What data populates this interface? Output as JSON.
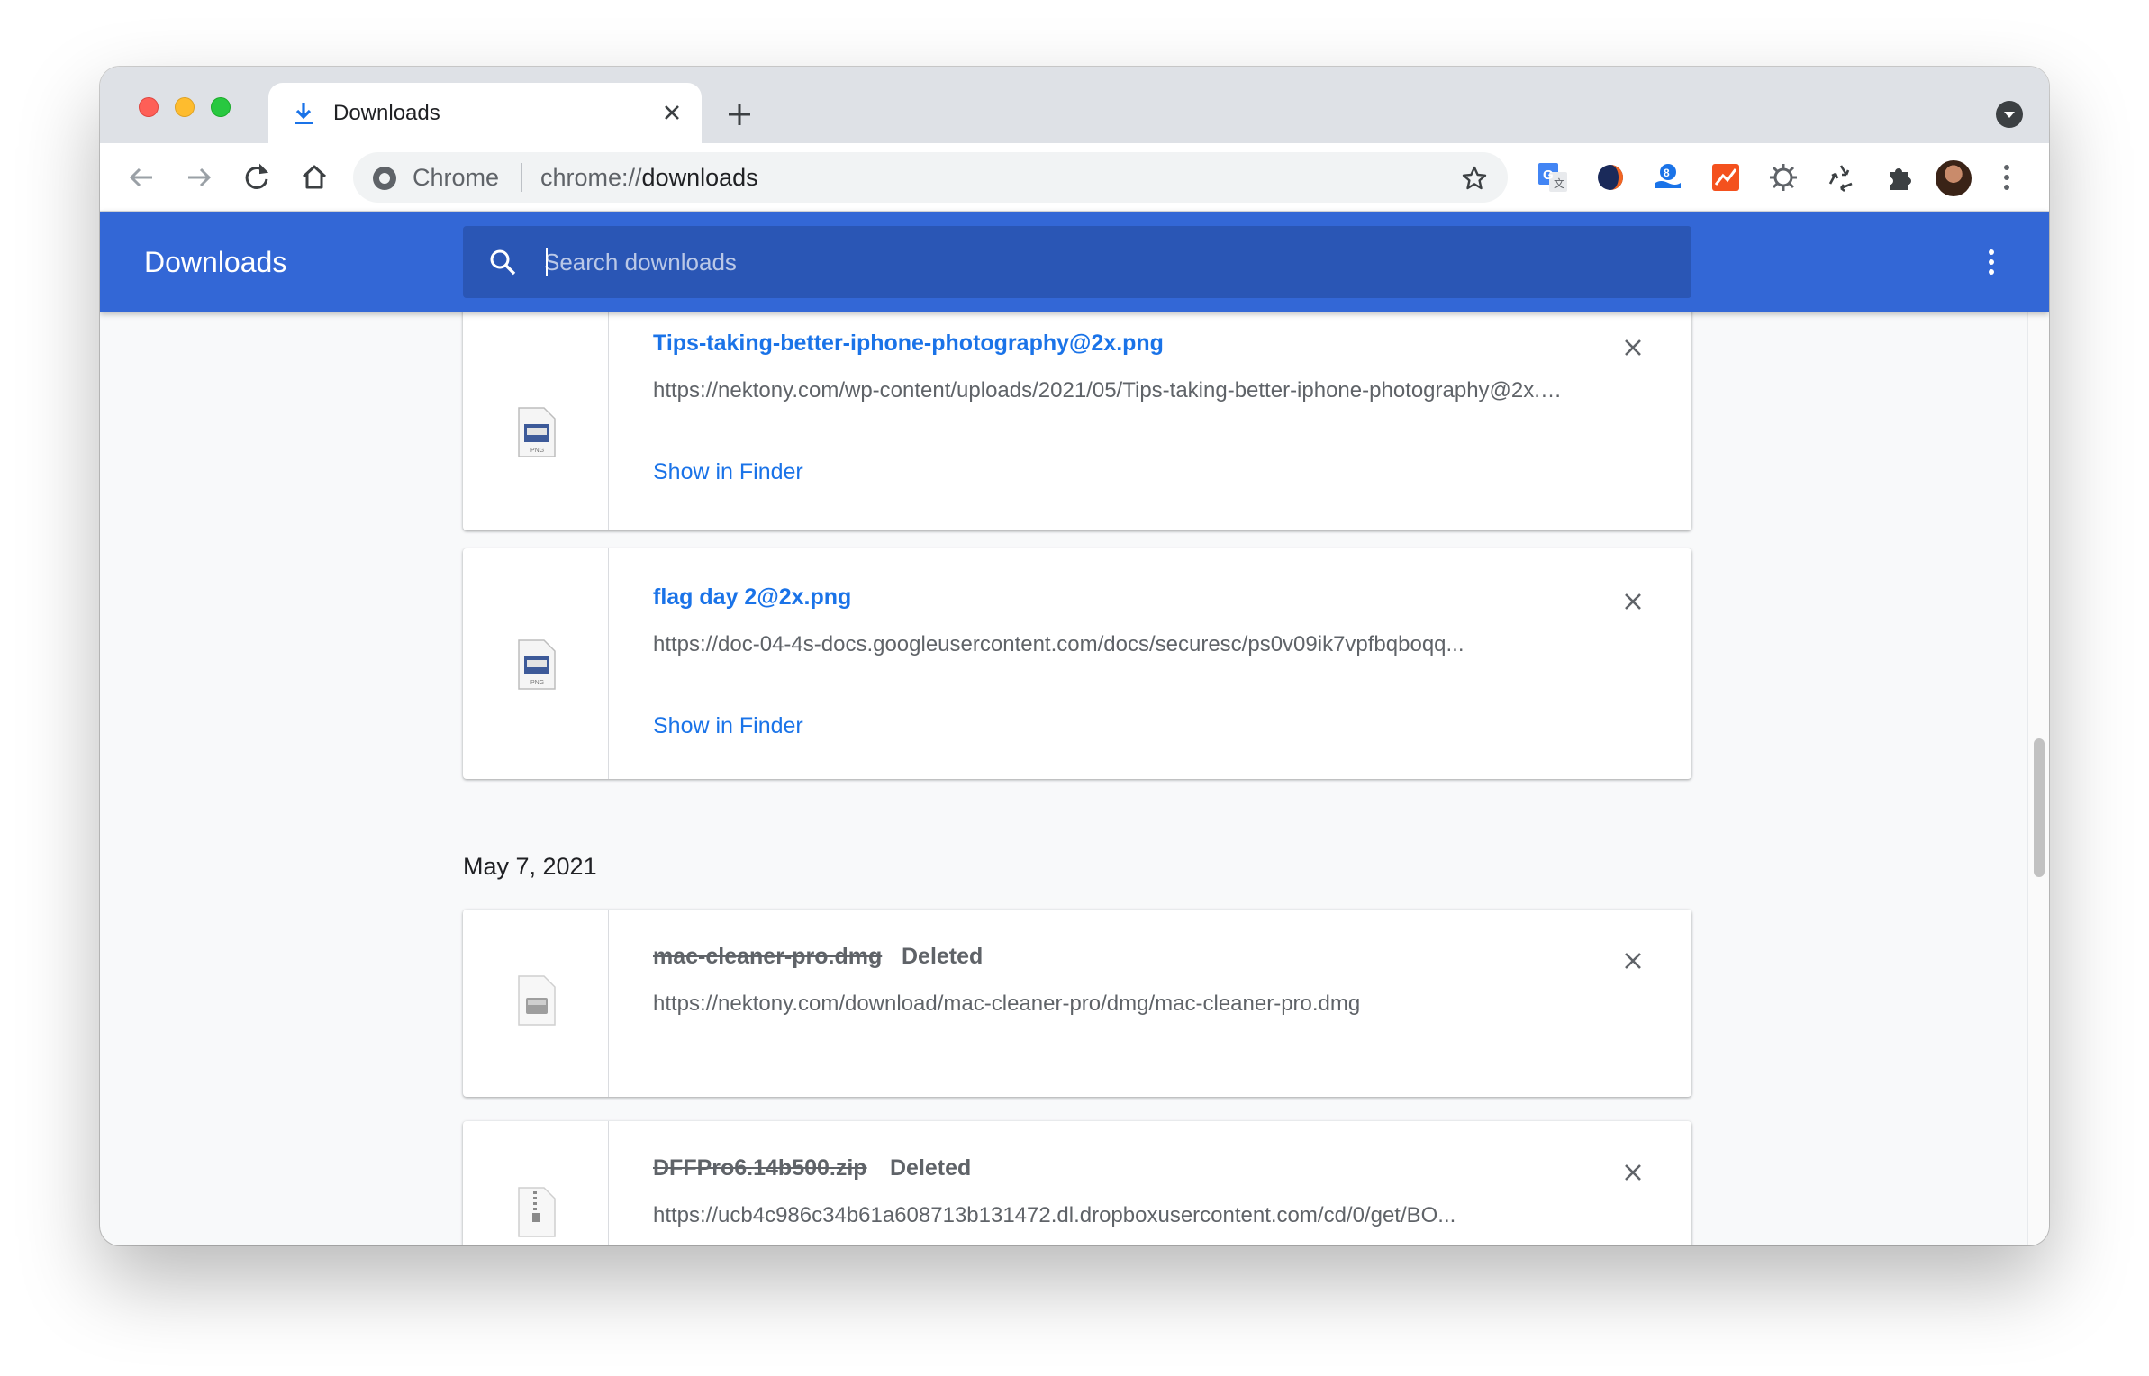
{
  "window": {
    "tab_title": "Downloads"
  },
  "omnibox": {
    "chip": "Chrome",
    "url_scheme": "chrome://",
    "url_host": "downloads"
  },
  "page": {
    "title": "Downloads",
    "search_placeholder": "Search downloads"
  },
  "downloads": [
    {
      "file_name": "Tips-taking-better-iphone-photography@2x.png",
      "url": "https://nektony.com/wp-content/uploads/2021/05/Tips-taking-better-iphone-photography@2x.png",
      "action": "Show in Finder",
      "icon": "png-file-icon"
    },
    {
      "file_name": "flag day 2@2x.png",
      "url": "https://doc-04-4s-docs.googleusercontent.com/docs/securesc/ps0v09ik7vpfbqboqq...",
      "action": "Show in Finder",
      "icon": "png-file-icon"
    }
  ],
  "date_group": "May 7, 2021",
  "deleted_downloads": [
    {
      "file_name": "mac-cleaner-pro.dmg",
      "status": "Deleted",
      "url": "https://nektony.com/download/mac-cleaner-pro/dmg/mac-cleaner-pro.dmg",
      "icon": "dmg-file-icon"
    },
    {
      "file_name": "DFFPro6.14b500.zip",
      "status": "Deleted",
      "url": "https://ucb4c986c34b61a608713b131472.dl.dropboxusercontent.com/cd/0/get/BO...",
      "icon": "zip-file-icon"
    }
  ],
  "colors": {
    "header_blue": "#3367d6",
    "search_blue": "#2a56b5",
    "link_blue": "#1a73e8"
  }
}
